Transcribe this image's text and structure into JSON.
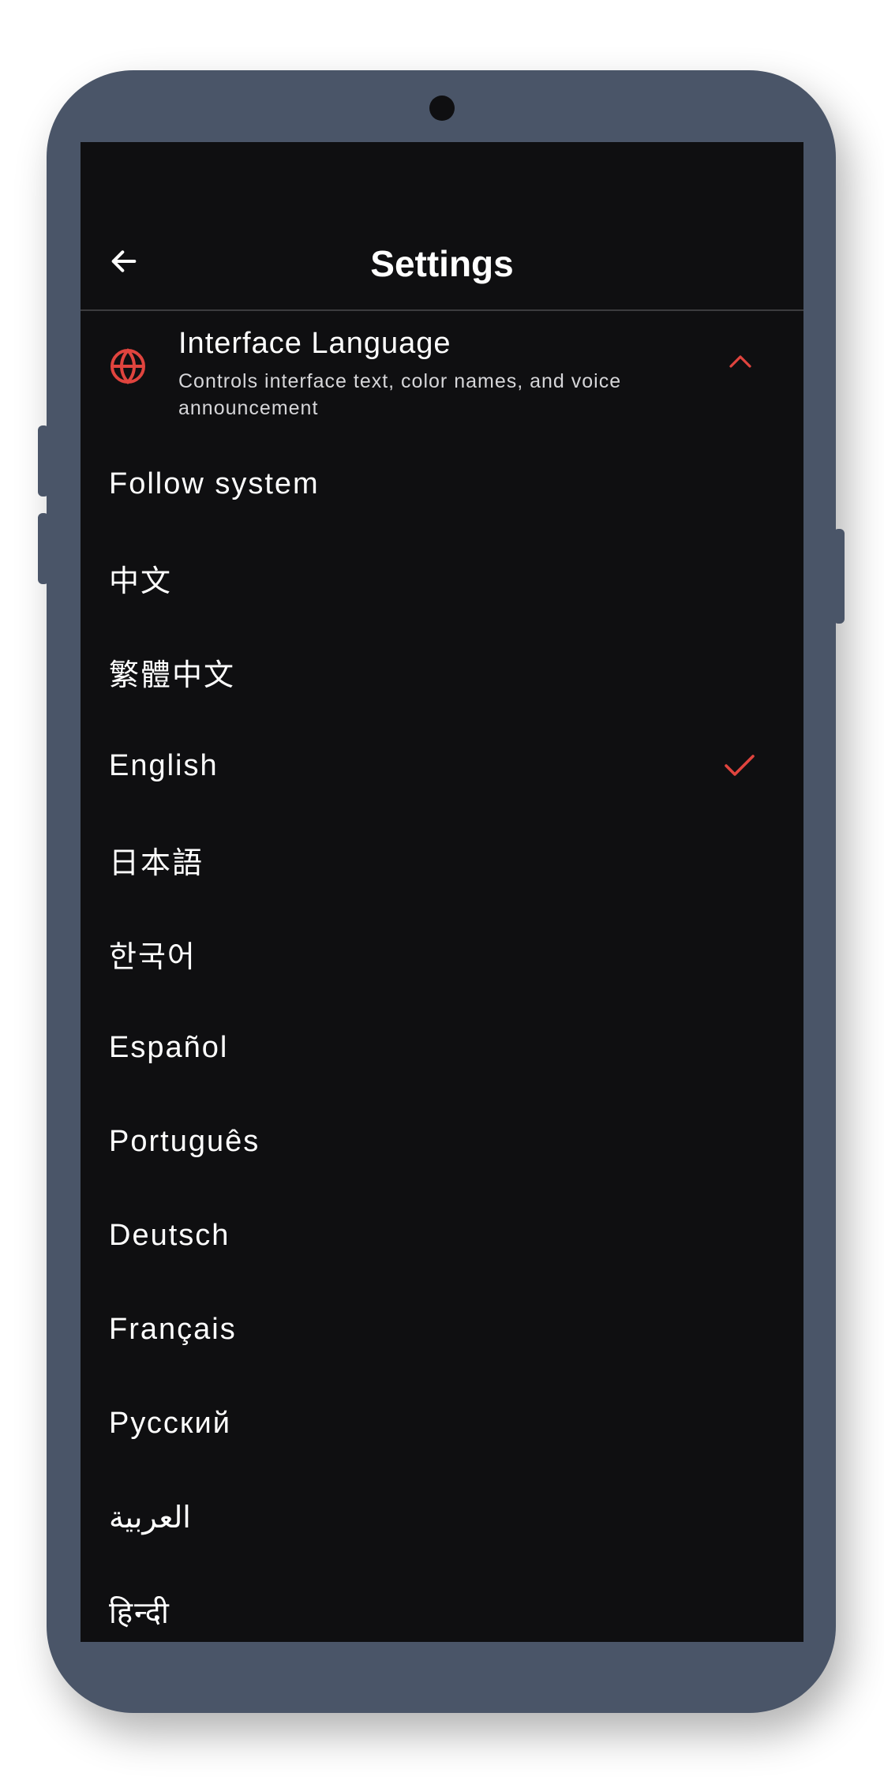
{
  "appbar": {
    "title": "Settings",
    "back_icon": "arrow-left-icon"
  },
  "section": {
    "icon": "globe-icon",
    "title": "Interface Language",
    "description": "Controls interface text, color names, and voice announcement",
    "expanded": true,
    "chevron_icon": "chevron-up-icon"
  },
  "languages": [
    {
      "label": "Follow system",
      "selected": false
    },
    {
      "label": "中文",
      "selected": false
    },
    {
      "label": "繁體中文",
      "selected": false
    },
    {
      "label": "English",
      "selected": true
    },
    {
      "label": "日本語",
      "selected": false
    },
    {
      "label": "한국어",
      "selected": false
    },
    {
      "label": "Español",
      "selected": false
    },
    {
      "label": "Português",
      "selected": false
    },
    {
      "label": "Deutsch",
      "selected": false
    },
    {
      "label": "Français",
      "selected": false
    },
    {
      "label": "Русский",
      "selected": false
    },
    {
      "label": "العربية",
      "selected": false
    },
    {
      "label": "हिन्दी",
      "selected": false
    }
  ],
  "colors": {
    "accent": "#e0443e",
    "screen_bg": "#0f0f11",
    "frame": "#4a5568",
    "text": "#ffffff",
    "divider": "#3c3c3f"
  }
}
